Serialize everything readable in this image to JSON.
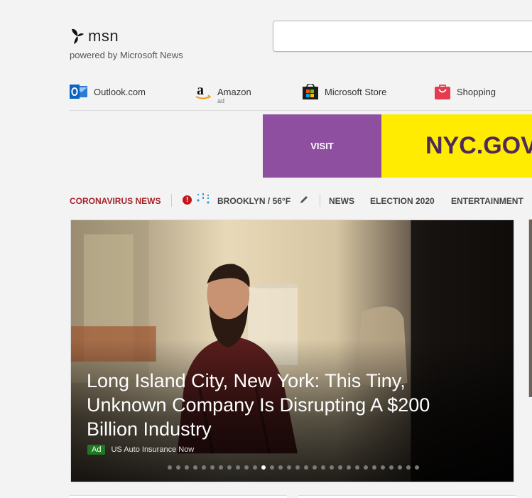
{
  "brand": {
    "logo_text": "msn",
    "tagline": "powered by Microsoft News"
  },
  "search": {
    "placeholder": "",
    "value": ""
  },
  "quicklinks": [
    {
      "label": "Outlook.com",
      "icon": "outlook-icon"
    },
    {
      "label": "Amazon",
      "sub": "ad",
      "icon": "amazon-icon"
    },
    {
      "label": "Microsoft Store",
      "icon": "microsoft-store-icon"
    },
    {
      "label": "Shopping",
      "icon": "shopping-bag-icon"
    }
  ],
  "ad_banner": {
    "cta": "VISIT",
    "text": "NYC.GOV",
    "colors": {
      "left": "#8e4fa0",
      "right": "#ffec00"
    }
  },
  "nav": {
    "coronavirus": "CORONAVIRUS NEWS",
    "weather": "BROOKLYN / 56°F",
    "items": [
      "NEWS",
      "ELECTION 2020",
      "ENTERTAINMENT"
    ]
  },
  "hero": {
    "title": "Long Island City, New York: This Tiny, Unknown Company Is Disrupting A $200 Billion Industry",
    "ad_badge": "Ad",
    "source": "US Auto Insurance Now",
    "slide_count": 30,
    "active_slide": 11
  }
}
